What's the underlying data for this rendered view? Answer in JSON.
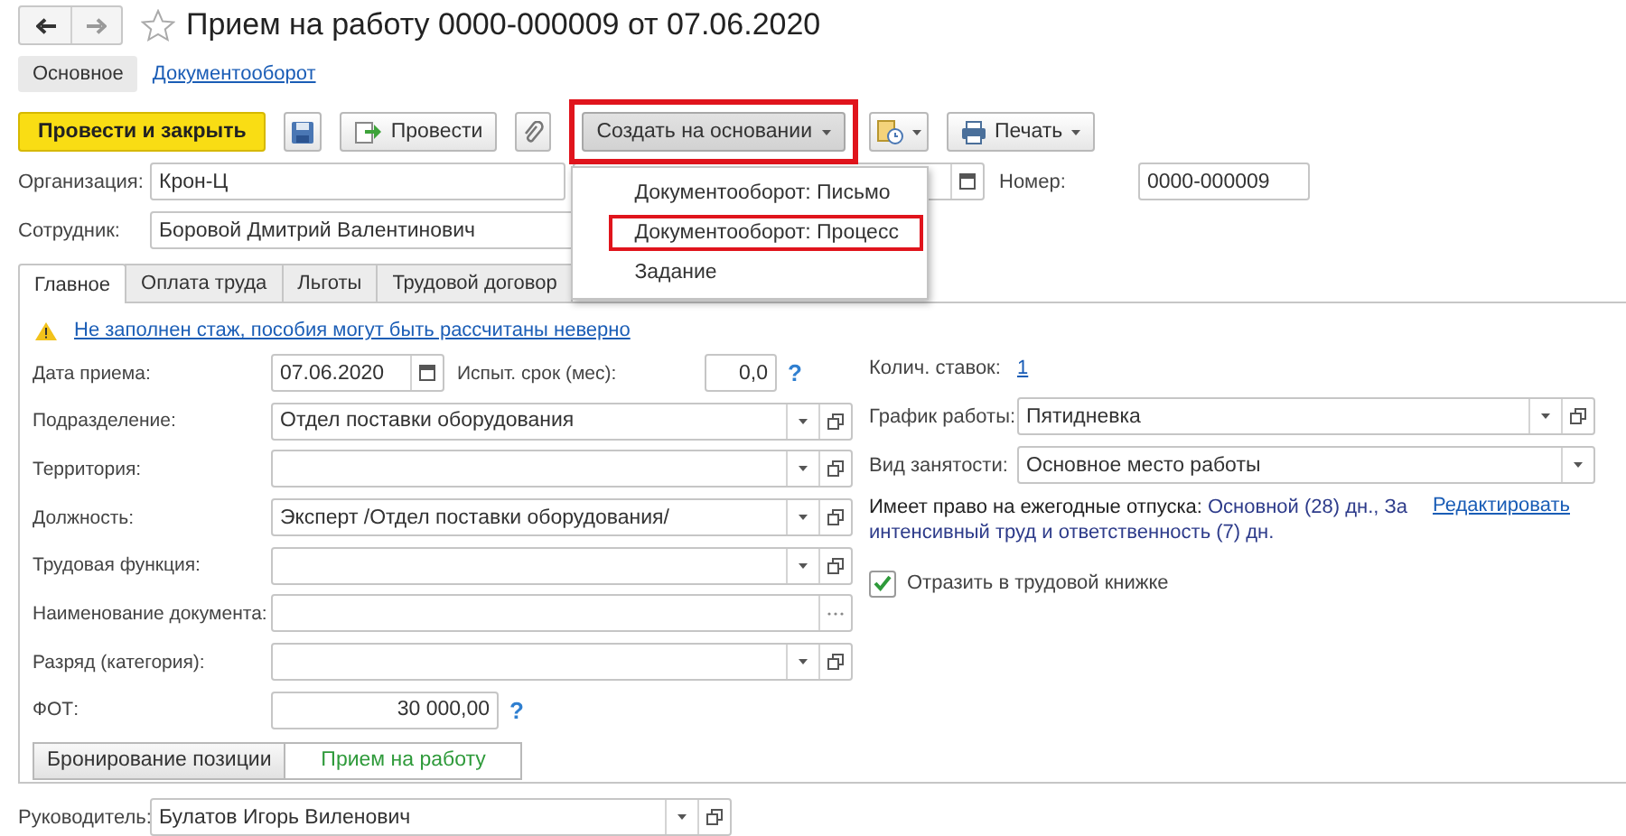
{
  "window": {
    "title": "Прием на работу 0000-000009 от 07.06.2020"
  },
  "nav": [
    {
      "label": "Основное",
      "selected": true
    },
    {
      "label": "Документооборот",
      "selected": false
    }
  ],
  "toolbar": [
    {
      "kind": "primary",
      "label": "Провести и закрыть"
    },
    {
      "kind": "save"
    },
    {
      "kind": "post",
      "label": "Провести"
    },
    {
      "kind": "attach"
    },
    {
      "kind": "menu",
      "label": "Создать на основании",
      "highlighted": true,
      "expanded": true,
      "items": [
        {
          "label": "Документооборот: Письмо",
          "highlighted": false
        },
        {
          "label": "Документооборот: Процесс",
          "highlighted": true
        },
        {
          "label": "Задание",
          "highlighted": false
        }
      ]
    },
    {
      "kind": "docs"
    },
    {
      "kind": "print",
      "label": "Печать"
    }
  ],
  "organization": {
    "label": "Организация:",
    "value": "Крон-Ц"
  },
  "number": {
    "label": "Номер:",
    "value": "0000-000009"
  },
  "employee": {
    "label": "Сотрудник:",
    "value": "Боровой Дмитрий Валентинович"
  },
  "tabs": [
    {
      "label": "Главное",
      "selected": true
    },
    {
      "label": "Оплата труда",
      "selected": false
    },
    {
      "label": "Льготы",
      "selected": false
    },
    {
      "label": "Трудовой договор",
      "selected": false
    }
  ],
  "warning": "Не заполнен стаж, пособия могут быть рассчитаны неверно",
  "left_fields": [
    {
      "label": "Дата приема:",
      "kind": "date",
      "value": "07.06.2020",
      "extra": {
        "label": "Испыт. срок (мес):",
        "value": "0,0",
        "help": "?"
      }
    },
    {
      "label": "Подразделение:",
      "kind": "select",
      "value": "Отдел поставки оборудования"
    },
    {
      "label": "Территория:",
      "kind": "select"
    },
    {
      "label": "Должность:",
      "kind": "select",
      "value": "Эксперт /Отдел поставки оборудования/"
    },
    {
      "label": "Трудовая функция:",
      "kind": "select"
    },
    {
      "label": "Наименование документа:",
      "kind": "choice"
    },
    {
      "label": "Разряд (категория):",
      "kind": "select"
    },
    {
      "label": "ФОТ:",
      "kind": "number",
      "value": "30 000,00",
      "help": "?"
    }
  ],
  "switch": [
    {
      "label": "Бронирование позиции",
      "selected": false
    },
    {
      "label": "Прием на работу",
      "selected": true
    }
  ],
  "right_fields": [
    {
      "label": "Колич. ставок:",
      "kind": "link",
      "value": "1"
    },
    {
      "label": "График работы:",
      "kind": "select",
      "value": "Пятидневка"
    },
    {
      "label": "Вид занятости:",
      "kind": "dropdown",
      "value": "Основное место работы"
    }
  ],
  "vacation": {
    "label": "Имеет право на ежегодные отпуска:",
    "value": "Основной (28) дн., За интенсивный труд и ответственность (7) дн.",
    "link": "Редактировать"
  },
  "checkbox": {
    "label": "Отразить в трудовой книжке",
    "checked": true
  },
  "manager": {
    "label": "Руководитель:",
    "value": "Булатов Игорь Виленович"
  }
}
